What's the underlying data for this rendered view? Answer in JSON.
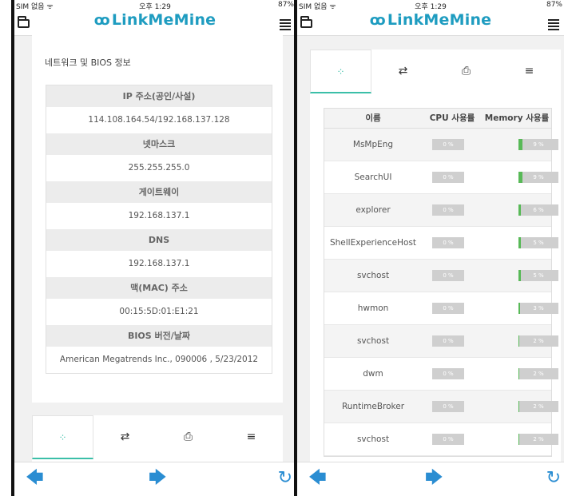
{
  "status": {
    "carrier": "SIM 없음 ᯤ",
    "time": "오후 1:29",
    "battery": "87%"
  },
  "brand": {
    "mark": "ꝏ",
    "name": "LinkMeMine"
  },
  "left": {
    "section_title": "네트워크 및 BIOS 정보",
    "info": [
      {
        "label": "IP 주소(공인/사설)",
        "value": "114.108.164.54/192.168.137.128"
      },
      {
        "label": "넷마스크",
        "value": "255.255.255.0"
      },
      {
        "label": "게이트웨이",
        "value": "192.168.137.1"
      },
      {
        "label": "DNS",
        "value": "192.168.137.1"
      },
      {
        "label": "맥(MAC) 주소",
        "value": "00:15:5D:01:E1:21"
      },
      {
        "label": "BIOS 버전/날짜",
        "value": "American Megatrends Inc., 090006 , 5/23/2012"
      }
    ]
  },
  "tabs": {
    "icons": [
      "spinner-icon",
      "exchange-icon",
      "print-icon",
      "bars-icon"
    ]
  },
  "right": {
    "headers": {
      "name": "이름",
      "cpu": "CPU 사용률",
      "mem": "Memory 사용률"
    },
    "processes": [
      {
        "name": "MsMpEng",
        "cpu": "0 %",
        "cpu_pct": 0,
        "mem": "9 %",
        "mem_pct": 9
      },
      {
        "name": "SearchUI",
        "cpu": "0 %",
        "cpu_pct": 0,
        "mem": "9 %",
        "mem_pct": 9
      },
      {
        "name": "explorer",
        "cpu": "0 %",
        "cpu_pct": 0,
        "mem": "6 %",
        "mem_pct": 6
      },
      {
        "name": "ShellExperienceHost",
        "cpu": "0 %",
        "cpu_pct": 0,
        "mem": "5 %",
        "mem_pct": 5
      },
      {
        "name": "svchost",
        "cpu": "0 %",
        "cpu_pct": 0,
        "mem": "5 %",
        "mem_pct": 5
      },
      {
        "name": "hwmon",
        "cpu": "0 %",
        "cpu_pct": 0,
        "mem": "3 %",
        "mem_pct": 3
      },
      {
        "name": "svchost",
        "cpu": "0 %",
        "cpu_pct": 0,
        "mem": "2 %",
        "mem_pct": 2
      },
      {
        "name": "dwm",
        "cpu": "0 %",
        "cpu_pct": 0,
        "mem": "2 %",
        "mem_pct": 2
      },
      {
        "name": "RuntimeBroker",
        "cpu": "0 %",
        "cpu_pct": 0,
        "mem": "2 %",
        "mem_pct": 2
      },
      {
        "name": "svchost",
        "cpu": "0 %",
        "cpu_pct": 0,
        "mem": "2 %",
        "mem_pct": 2
      }
    ]
  },
  "nav": {
    "back": "🡄",
    "forward": "🡆",
    "reload": "↻"
  },
  "colors": {
    "brand": "#1e9cc0",
    "accent": "#3bbfa8",
    "nav": "#2a8dd2",
    "bar_fill": "#58b957",
    "bar_track": "#cfcfcf"
  }
}
